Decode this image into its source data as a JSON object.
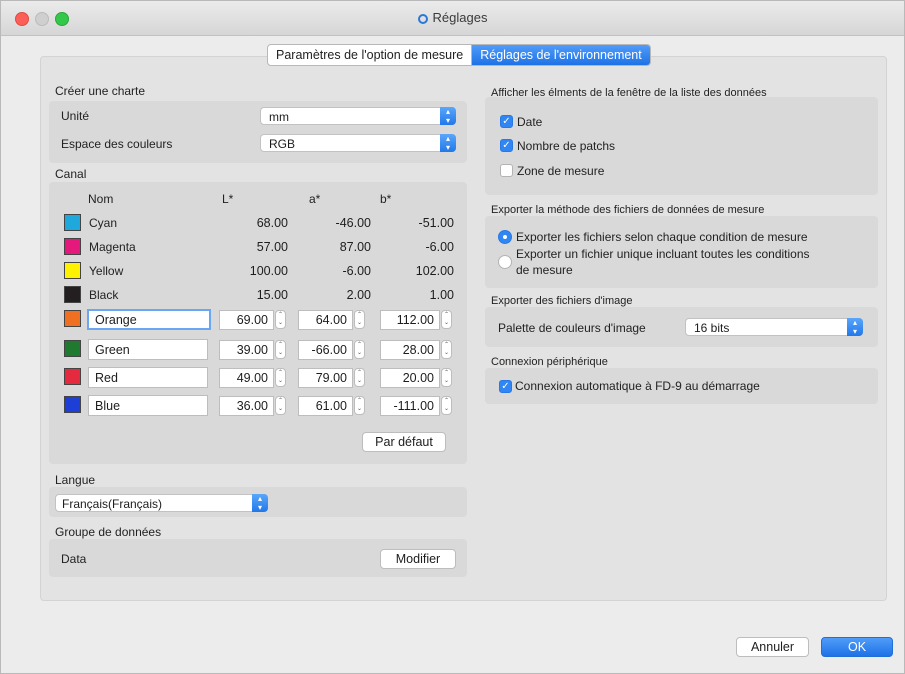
{
  "window": {
    "title": "Réglages"
  },
  "tabs": [
    {
      "label": "Paramètres de l'option de mesure",
      "active": false
    },
    {
      "label": "Réglages de l'environnement",
      "active": true
    }
  ],
  "left": {
    "chart_section": "Créer une charte",
    "unit_label": "Unité",
    "unit_value": "mm",
    "colorspace_label": "Espace des couleurs",
    "colorspace_value": "RGB",
    "canal_section": "Canal",
    "col_name": "Nom",
    "col_l": "L*",
    "col_a": "a*",
    "col_b": "b*",
    "fixed_rows": [
      {
        "name": "Cyan",
        "L": "68.00",
        "a": "-46.00",
        "b": "-51.00",
        "color": "#1ea8dc"
      },
      {
        "name": "Magenta",
        "L": "57.00",
        "a": "87.00",
        "b": "-6.00",
        "color": "#e4197b"
      },
      {
        "name": "Yellow",
        "L": "100.00",
        "a": "-6.00",
        "b": "102.00",
        "color": "#fff200"
      },
      {
        "name": "Black",
        "L": "15.00",
        "a": "2.00",
        "b": "1.00",
        "color": "#231f20"
      }
    ],
    "edit_rows": [
      {
        "name": "Orange",
        "L": "69.00",
        "a": "64.00",
        "b": "112.00",
        "color": "#f07022"
      },
      {
        "name": "Green",
        "L": "39.00",
        "a": "-66.00",
        "b": "28.00",
        "color": "#1f7a30"
      },
      {
        "name": "Red",
        "L": "49.00",
        "a": "79.00",
        "b": "20.00",
        "color": "#e5293f"
      },
      {
        "name": "Blue",
        "L": "36.00",
        "a": "61.00",
        "b": "-111.00",
        "color": "#1d3fd6"
      }
    ],
    "default_button": "Par défaut",
    "language_section": "Langue",
    "language_value": "Français(Français)",
    "group_section": "Groupe de données",
    "group_value": "Data",
    "modify_button": "Modifier"
  },
  "right": {
    "display_section": "Afficher les élments de la fenêtre de la liste des données",
    "display_items": [
      {
        "label": "Date",
        "checked": true
      },
      {
        "label": "Nombre de patchs",
        "checked": true
      },
      {
        "label": "Zone de mesure",
        "checked": false
      }
    ],
    "export_method_section": "Exporter la méthode des fichiers de données de mesure",
    "export_option_1": "Exporter les fichiers selon chaque condition de mesure",
    "export_option_2_line1": "Exporter un fichier unique incluant toutes les conditions",
    "export_option_2_line2": "de mesure",
    "export_images_section": "Exporter des fichiers d'image",
    "palette_label": "Palette de couleurs d'image",
    "palette_value": "16 bits",
    "connection_section": "Connexion périphérique",
    "auto_connect": "Connexion automatique à FD-9 au démarrage"
  },
  "footer": {
    "cancel": "Annuler",
    "ok": "OK"
  }
}
